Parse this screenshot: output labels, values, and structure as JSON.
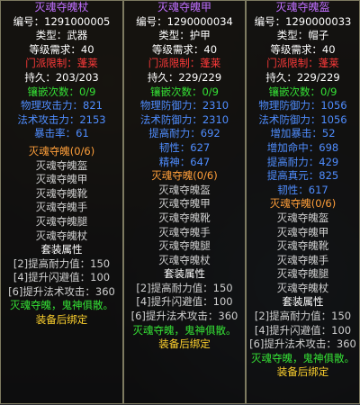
{
  "panels": [
    {
      "lines": [
        {
          "t": "灭魂夺魄杖",
          "c": "title"
        },
        {
          "t": "编号：1291000005",
          "c": "white"
        },
        {
          "t": "类型：武器",
          "c": "white"
        },
        {
          "t": "等级需求：40",
          "c": "white"
        },
        {
          "t": "门派限制：蓬莱",
          "c": "red"
        },
        {
          "t": "持久：203/203",
          "c": "white"
        },
        {
          "t": "镶嵌次数：0/9",
          "c": "green"
        },
        {
          "t": "物理攻击力：821",
          "c": "blue"
        },
        {
          "t": "法术攻击力：2153",
          "c": "blue"
        },
        {
          "t": "暴击率：61",
          "c": "blue"
        },
        {
          "t": "",
          "c": "gap"
        },
        {
          "t": "灭魂夺魄(0/6)",
          "c": "sect"
        },
        {
          "t": "灭魂夺魄盔",
          "c": "grey"
        },
        {
          "t": "灭魂夺魄甲",
          "c": "grey"
        },
        {
          "t": "灭魂夺魄靴",
          "c": "grey"
        },
        {
          "t": "灭魂夺魄手",
          "c": "grey"
        },
        {
          "t": "灭魂夺魄腿",
          "c": "grey"
        },
        {
          "t": "灭魂夺魄杖",
          "c": "grey"
        },
        {
          "t": "套装属性",
          "c": "white"
        },
        {
          "t": "[2]提高耐力值：150",
          "c": "grey"
        },
        {
          "t": "[4]提升闪避值：100",
          "c": "grey"
        },
        {
          "t": "[6]提升法术攻击：360",
          "c": "grey"
        },
        {
          "t": "灭魂夺魄，鬼神俱散。",
          "c": "green"
        },
        {
          "t": "装备后绑定",
          "c": "bound"
        }
      ]
    },
    {
      "lines": [
        {
          "t": "灭魂夺魄甲",
          "c": "title"
        },
        {
          "t": "编号：1290000034",
          "c": "white"
        },
        {
          "t": "类型：护甲",
          "c": "white"
        },
        {
          "t": "等级需求：40",
          "c": "white"
        },
        {
          "t": "门派限制：蓬莱",
          "c": "red"
        },
        {
          "t": "持久：229/229",
          "c": "hl"
        },
        {
          "t": "镶嵌次数：0/9",
          "c": "green"
        },
        {
          "t": "物理防御力：2310",
          "c": "blue"
        },
        {
          "t": "法术防御力：2310",
          "c": "blue"
        },
        {
          "t": "提高耐力：692",
          "c": "blue"
        },
        {
          "t": "韧性：627",
          "c": "blue"
        },
        {
          "t": "精神：647",
          "c": "blue"
        },
        {
          "t": "灭魂夺魄(0/6)",
          "c": "sect"
        },
        {
          "t": "灭魂夺魄盔",
          "c": "grey"
        },
        {
          "t": "灭魂夺魄甲",
          "c": "grey"
        },
        {
          "t": "灭魂夺魄靴",
          "c": "grey"
        },
        {
          "t": "灭魂夺魄手",
          "c": "grey"
        },
        {
          "t": "灭魂夺魄腿",
          "c": "grey"
        },
        {
          "t": "灭魂夺魄杖",
          "c": "grey"
        },
        {
          "t": "套装属性",
          "c": "white"
        },
        {
          "t": "[2]提高耐力值：150",
          "c": "grey"
        },
        {
          "t": "[4]提升闪避值：100",
          "c": "grey"
        },
        {
          "t": "[6]提升法术攻击：360",
          "c": "grey"
        },
        {
          "t": "灭魂夺魄，鬼神俱散。",
          "c": "green"
        },
        {
          "t": "装备后绑定",
          "c": "bound"
        }
      ]
    },
    {
      "lines": [
        {
          "t": "灭魂夺魄盔",
          "c": "title"
        },
        {
          "t": "编号：1290000033",
          "c": "white"
        },
        {
          "t": "类型：帽子",
          "c": "white"
        },
        {
          "t": "等级需求：40",
          "c": "white"
        },
        {
          "t": "门派限制：蓬莱",
          "c": "red"
        },
        {
          "t": "持久：229/229",
          "c": "white"
        },
        {
          "t": "镶嵌次数：0/9",
          "c": "green"
        },
        {
          "t": "物理防御力：1056",
          "c": "blue"
        },
        {
          "t": "法术防御力：1056",
          "c": "blue"
        },
        {
          "t": "增加暴击：52",
          "c": "blue"
        },
        {
          "t": "增加命中：698",
          "c": "blue"
        },
        {
          "t": "提高耐力：429",
          "c": "blue"
        },
        {
          "t": "提高真元：825",
          "c": "blue"
        },
        {
          "t": "韧性：617",
          "c": "blue"
        },
        {
          "t": "灭魂夺魄(0/6)",
          "c": "sect"
        },
        {
          "t": "灭魂夺魄盔",
          "c": "grey"
        },
        {
          "t": "灭魂夺魄甲",
          "c": "grey"
        },
        {
          "t": "灭魂夺魄靴",
          "c": "grey"
        },
        {
          "t": "灭魂夺魄手",
          "c": "grey"
        },
        {
          "t": "灭魂夺魄腿",
          "c": "grey"
        },
        {
          "t": "灭魂夺魄杖",
          "c": "grey"
        },
        {
          "t": "套装属性",
          "c": "white"
        },
        {
          "t": "[2]提高耐力值：150",
          "c": "grey"
        },
        {
          "t": "[4]提升闪避值：100",
          "c": "grey"
        },
        {
          "t": "[6]提升法术攻击：360",
          "c": "grey"
        },
        {
          "t": "灭魂夺魄，鬼神俱散。",
          "c": "green"
        },
        {
          "t": "装备后绑定",
          "c": "bound"
        }
      ]
    }
  ]
}
